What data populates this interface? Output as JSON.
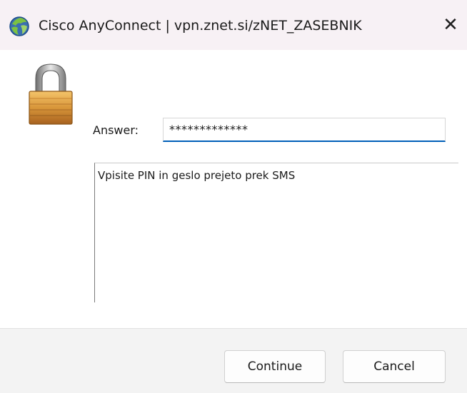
{
  "window": {
    "title": "Cisco AnyConnect | vpn.znet.si/zNET_ZASEBNIK",
    "close_glyph": "✕"
  },
  "icons": {
    "app": "cisco-anyconnect-icon",
    "lock": "padlock-icon",
    "close": "close-icon"
  },
  "form": {
    "answer_label": "Answer:",
    "answer_value": "*************",
    "message": "Vpisite PIN in geslo prejeto prek SMS"
  },
  "buttons": {
    "continue_label": "Continue",
    "cancel_label": "Cancel"
  },
  "colors": {
    "titlebar": "#f7f1f5",
    "accent": "#005fb8",
    "footer": "#f3f3f3"
  }
}
